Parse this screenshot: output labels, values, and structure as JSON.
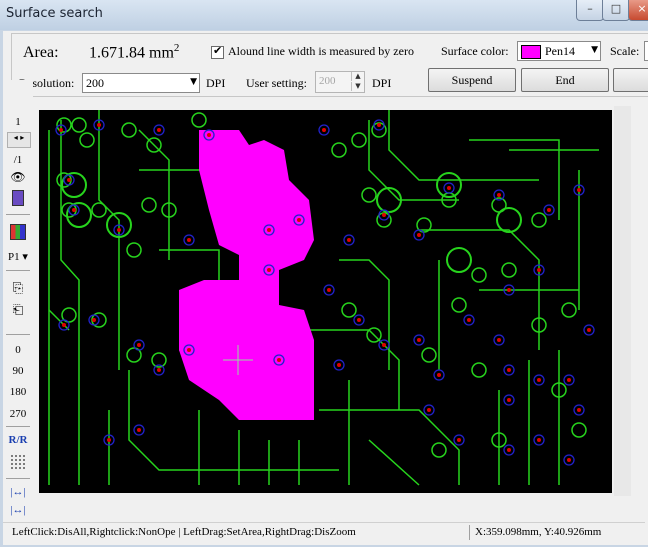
{
  "window": {
    "title": "Surface search"
  },
  "area": {
    "label": "Area:",
    "value": "1.671.84",
    "unit": "mm",
    "unit_sup": "2"
  },
  "options": {
    "zero_width_label": "Alound line width is measured by zero",
    "zero_width_checked": true
  },
  "surface_color": {
    "label": "Surface color:",
    "value": "Pen14",
    "swatch": "#ff00ff"
  },
  "scale": {
    "label": "Scale:"
  },
  "resolution": {
    "label": "Resolution:",
    "value": "200",
    "unit": "DPI"
  },
  "user_setting": {
    "label": "User setting:",
    "value": "200",
    "unit": "DPI"
  },
  "buttons": {
    "suspend": "Suspend",
    "end": "End"
  },
  "leftbar": {
    "page_top": "1",
    "page_div": "/1",
    "layer": "P1",
    "rot0": "0",
    "rot90": "90",
    "rot180": "180",
    "rot270": "270"
  },
  "status": {
    "hint": "LeftClick:DisAll,Rightclick:NonOpe  |  LeftDrag:SetArea,RightDrag:DisZoom",
    "coords": "X:359.098mm, Y:40.926mm"
  },
  "colors": {
    "trace": "#27d41d",
    "pad_ring": "#2222cc",
    "via": "#e00000",
    "fill": "#ff00ff",
    "background": "#000000"
  }
}
